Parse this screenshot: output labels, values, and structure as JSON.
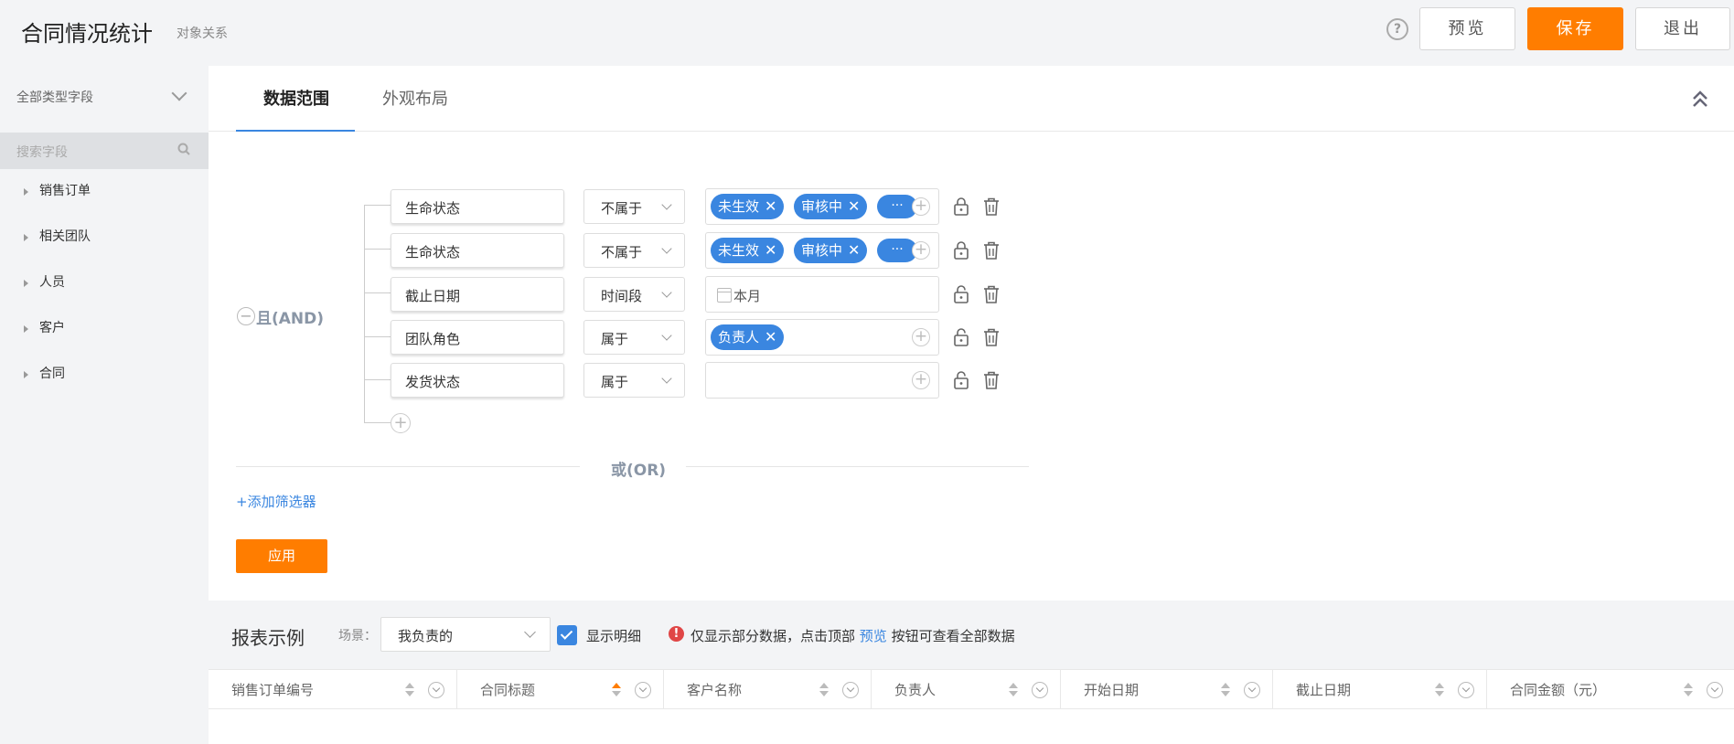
{
  "header": {
    "title": "合同情况统计",
    "subtitle": "对象关系",
    "help_icon": "?",
    "preview_label": "预览",
    "save_label": "保存",
    "exit_label": "退出"
  },
  "sidebar": {
    "field_type_select": "全部类型字段",
    "search_placeholder": "搜索字段",
    "items": [
      {
        "label": "销售订单"
      },
      {
        "label": "相关团队"
      },
      {
        "label": "人员"
      },
      {
        "label": "客户"
      },
      {
        "label": "合同"
      }
    ]
  },
  "tabs": [
    {
      "label": "数据范围",
      "active": true
    },
    {
      "label": "外观布局",
      "active": false
    }
  ],
  "filters": {
    "group_label": "且(AND)",
    "conditions": [
      {
        "field": "生命状态",
        "operator": "不属于",
        "tags": [
          "未生效",
          "审核中"
        ],
        "more": "···"
      },
      {
        "field": "生命状态",
        "operator": "不属于",
        "tags": [
          "未生效",
          "审核中"
        ],
        "more": "···"
      },
      {
        "field": "截止日期",
        "operator": "时间段",
        "value": "本月"
      },
      {
        "field": "团队角色",
        "operator": "属于",
        "tags": [
          "负责人"
        ]
      },
      {
        "field": "发货状态",
        "operator": "属于",
        "tags": []
      }
    ],
    "or_label": "或(OR)",
    "add_filter_label": "+添加筛选器",
    "apply_label": "应用",
    "tag_remove_glyph": "✕",
    "plus_glyph": "+",
    "minus_glyph": "−"
  },
  "report": {
    "title": "报表示例",
    "scene_label": "场景：",
    "scene_value": "我负责的",
    "show_detail_label": "显示明细",
    "show_detail_checked": true,
    "warn_glyph": "!",
    "notice_before": "仅显示部分数据，点击顶部",
    "notice_link": "预览",
    "notice_after": "按钮可查看全部数据",
    "columns": [
      {
        "label": "销售订单编号",
        "sort": "none"
      },
      {
        "label": "合同标题",
        "sort": "asc"
      },
      {
        "label": "客户名称",
        "sort": "none"
      },
      {
        "label": "负责人",
        "sort": "none"
      },
      {
        "label": "开始日期",
        "sort": "none"
      },
      {
        "label": "截止日期",
        "sort": "none"
      },
      {
        "label": "合同金额（元）",
        "sort": "none"
      }
    ]
  },
  "colors": {
    "accent_blue": "#3a86e0",
    "primary_orange": "#ff7d00"
  }
}
